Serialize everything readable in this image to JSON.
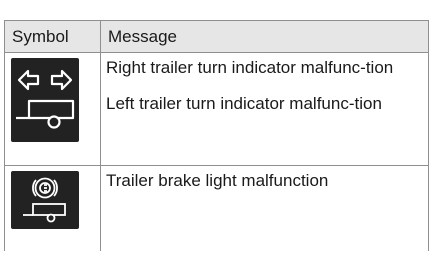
{
  "table": {
    "headers": {
      "symbol": "Symbol",
      "message": "Message"
    },
    "rows": [
      {
        "icon": "trailer-turn-indicator-icon",
        "messages": [
          "Right trailer turn indicator malfunc-tion",
          "Left trailer turn indicator malfunc-tion"
        ]
      },
      {
        "icon": "trailer-brake-light-icon",
        "messages": [
          "Trailer brake light malfunction"
        ]
      }
    ]
  },
  "colors": {
    "icon_background": "#222222",
    "icon_foreground": "#ffffff",
    "header_background": "#e6e6e6"
  }
}
